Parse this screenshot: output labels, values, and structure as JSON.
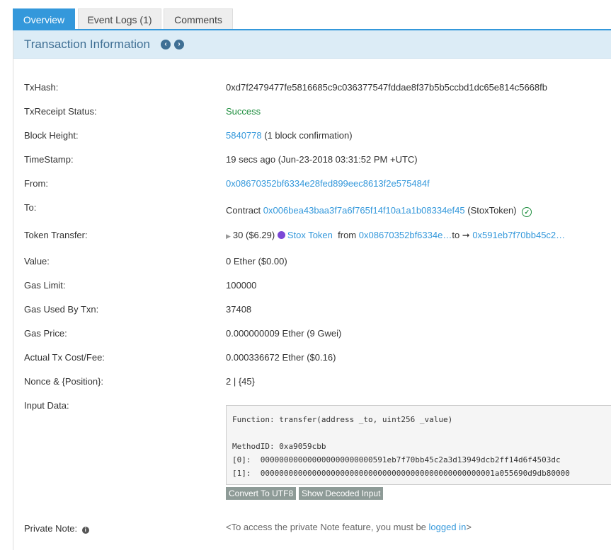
{
  "tabs": [
    {
      "label": "Overview"
    },
    {
      "label": "Event Logs (1)"
    },
    {
      "label": "Comments"
    }
  ],
  "panel_title": "Transaction Information",
  "fields": {
    "txhash": {
      "label": "TxHash:",
      "value": "0xd7f2479477fe5816685c9c036377547fddae8f37b5b5ccbd1dc65e814c5668fb"
    },
    "status": {
      "label": "TxReceipt Status:",
      "value": "Success"
    },
    "block": {
      "label": "Block Height:",
      "link": "5840778",
      "suffix": "(1 block confirmation)"
    },
    "timestamp": {
      "label": "TimeStamp:",
      "value": "19 secs ago (Jun-23-2018 03:31:52 PM +UTC)"
    },
    "from": {
      "label": "From:",
      "value": "0x08670352bf6334e28fed899eec8613f2e575484f"
    },
    "to": {
      "label": "To:",
      "prefix": "Contract",
      "link": "0x006bea43baa3f7a6f765f14f10a1a1b08334ef45",
      "suffix": "(StoxToken)"
    },
    "token_transfer": {
      "label": "Token Transfer:",
      "amount": "30 ($6.29)",
      "token": "Stox Token",
      "from_word": "from",
      "from_addr": "0x08670352bf6334e…",
      "to_word": "to",
      "to_addr": "0x591eb7f70bb45c2…"
    },
    "value": {
      "label": "Value:",
      "value": "0 Ether ($0.00)"
    },
    "gas_limit": {
      "label": "Gas Limit:",
      "value": "100000"
    },
    "gas_used": {
      "label": "Gas Used By Txn:",
      "value": "37408"
    },
    "gas_price": {
      "label": "Gas Price:",
      "value": "0.000000009 Ether (9 Gwei)"
    },
    "fee": {
      "label": "Actual Tx Cost/Fee:",
      "value": "0.000336672 Ether ($0.16)"
    },
    "nonce": {
      "label": "Nonce & {Position}:",
      "value": "2 | {45}"
    },
    "input": {
      "label": "Input Data:",
      "text": "Function: transfer(address _to, uint256 _value)\n\nMethodID: 0xa9059cbb\n[0]:  000000000000000000000000591eb7f70bb45c2a3d13949dcb2ff14d6f4503dc\n[1]:  00000000000000000000000000000000000000000000000001a055690d9db80000"
    },
    "private_note": {
      "label": "Private Note:",
      "pre": "<To access the private Note feature, you must be",
      "link": "logged in",
      "post": ">"
    }
  },
  "buttons": {
    "utf8": "Convert To UTF8",
    "decoded": "Show Decoded Input"
  },
  "icons": {
    "prev": "chevron-left-circle-icon",
    "next": "chevron-right-circle-icon",
    "check": "check-circle-icon",
    "info": "info-circle-icon",
    "token": "stox-token-icon",
    "arrow": "right-arrow-icon"
  },
  "colors": {
    "accent": "#3498db",
    "header_bg": "#dcecf6",
    "title": "#3f6f94",
    "success": "#1e8e3e",
    "token": "#7b48d6",
    "button": "#8e9b97"
  }
}
